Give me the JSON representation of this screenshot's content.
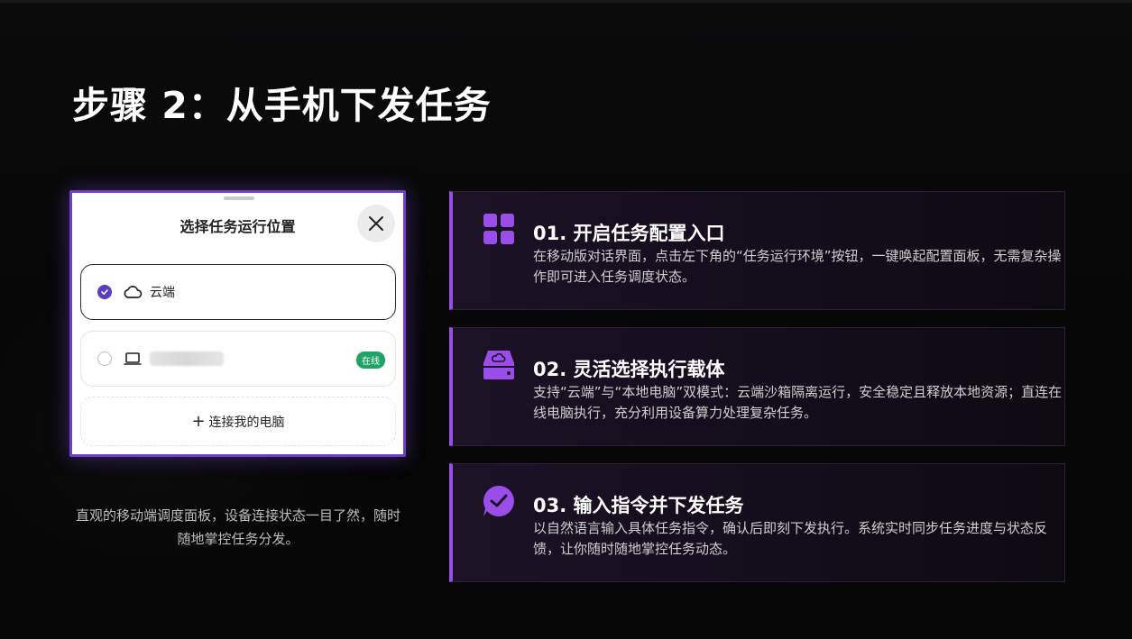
{
  "title": "步骤 2：从手机下发任务",
  "phone": {
    "sheet_title": "选择任务运行位置",
    "options": [
      {
        "label": "云端",
        "selected": true,
        "icon": "cloud-icon"
      },
      {
        "label": "",
        "selected": false,
        "icon": "laptop-icon",
        "badge": "在线"
      }
    ],
    "add_label": "连接我的电脑"
  },
  "caption": "直观的移动端调度面板，设备连接状态一目了然，随时随地掌控任务分发。",
  "cards": [
    {
      "title": "01. 开启任务配置入口",
      "desc": "在移动版对话界面，点击左下角的“任务运行环境”按钮，一键唤起配置面板，无需复杂操作即可进入任务调度状态。",
      "icon": "grid-icon"
    },
    {
      "title": "02. 灵活选择执行载体",
      "desc": "支持“云端”与“本地电脑”双模式：云端沙箱隔离运行，安全稳定且释放本地资源；直连在线电脑执行，充分利用设备算力处理复杂任务。",
      "icon": "cloud-drive-icon"
    },
    {
      "title": "03. 输入指令并下发任务",
      "desc": "以自然语言输入具体任务指令，确认后即刻下发执行。系统实时同步任务进度与状态反馈，让你随时随地掌控任务动态。",
      "icon": "check-bubble-icon"
    }
  ],
  "colors": {
    "accent": "#9a4de8",
    "radio": "#5b3cc4",
    "online": "#20a466"
  }
}
